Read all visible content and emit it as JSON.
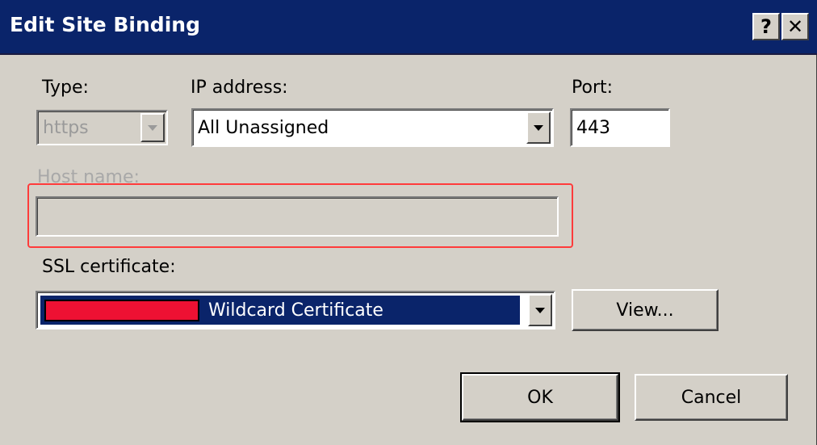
{
  "window": {
    "title": "Edit Site Binding",
    "help_label": "?",
    "close_label": "✕"
  },
  "type": {
    "label": "Type:",
    "value": "https"
  },
  "ip_address": {
    "label": "IP address:",
    "value": "All Unassigned"
  },
  "port": {
    "label": "Port:",
    "value": "443"
  },
  "host_name": {
    "label": "Host name:",
    "value": ""
  },
  "ssl_certificate": {
    "label": "SSL certificate:",
    "value": "Wildcard Certificate",
    "redaction_color": "#ee1133"
  },
  "buttons": {
    "view": "View...",
    "ok": "OK",
    "cancel": "Cancel"
  },
  "colors": {
    "titlebar": "#0a246a",
    "dialog_bg": "#d4d0c8",
    "highlight": "#ff3b3b"
  },
  "icons": {
    "help": "help-icon",
    "close": "close-icon",
    "dropdown": "chevron-down-icon"
  }
}
